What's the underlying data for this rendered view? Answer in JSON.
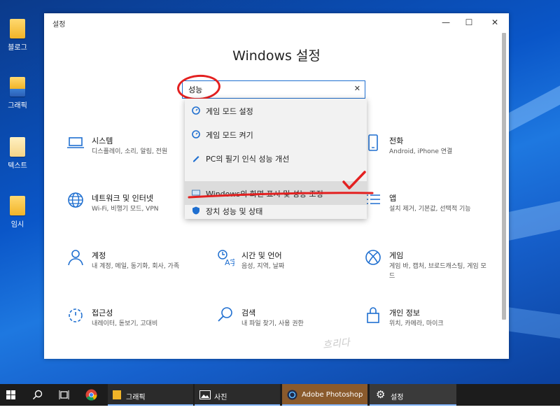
{
  "desktop": {
    "icons": [
      {
        "label": "블로그"
      },
      {
        "label": "그래픽"
      },
      {
        "label": "텍스트"
      },
      {
        "label": "임시"
      }
    ]
  },
  "window": {
    "title": "설정",
    "controls": {
      "minimize": "—",
      "maximize": "☐",
      "close": "✕"
    }
  },
  "settings": {
    "heading": "Windows 설정",
    "search": {
      "value": "성능",
      "clear": "✕"
    }
  },
  "dropdown": {
    "items": [
      {
        "label": "게임 모드 설정"
      },
      {
        "label": "게임 모드 켜기"
      },
      {
        "label": "PC의 필기 인식 성능 개선"
      },
      {
        "label": "Windows의 화면 표시 및 성능 조정"
      },
      {
        "label": "장치 성능 및 상태"
      }
    ]
  },
  "tiles": {
    "system": {
      "title": "시스템",
      "sub": "디스플레이, 소리, 알림, 전원"
    },
    "phone": {
      "title": "전화",
      "sub": "Android, iPhone 연결"
    },
    "network": {
      "title": "네트워크 및 인터넷",
      "sub": "Wi-Fi, 비행기 모드, VPN"
    },
    "apps": {
      "title": "앱",
      "sub": "설치 제거, 기본값, 선택적 기능"
    },
    "accounts": {
      "title": "계정",
      "sub": "내 계정, 메일, 동기화, 회사, 가족"
    },
    "time": {
      "title": "시간 및 언어",
      "sub": "음성, 지역, 날짜"
    },
    "gaming": {
      "title": "게임",
      "sub": "게임 바, 캡처, 브로드캐스팅, 게임 모드"
    },
    "ease": {
      "title": "접근성",
      "sub": "내레이터, 돋보기, 고대비"
    },
    "search": {
      "title": "검색",
      "sub": "내 파일 찾기, 사용 권한"
    },
    "privacy": {
      "title": "개인 정보",
      "sub": "위치, 카메라, 마이크"
    }
  },
  "watermark": "흐리다",
  "taskbar": {
    "items": [
      {
        "label": "그래픽"
      },
      {
        "label": "사진"
      },
      {
        "label": "Adobe Photoshop"
      },
      {
        "label": "설정"
      }
    ]
  },
  "colors": {
    "accent": "#1f6fd0",
    "annotation": "#e32020",
    "taskbar": "#1c1c1c"
  }
}
